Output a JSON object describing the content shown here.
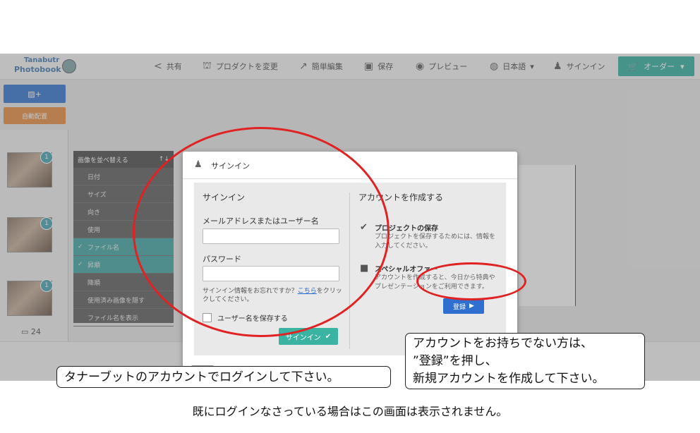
{
  "app": {
    "logo_top": "Tanabutr",
    "logo_bottom": "Photobook",
    "toolbar": {
      "share": "共有",
      "change_product": "プロダクトを変更",
      "easy_edit": "簡単編集",
      "save": "保存",
      "preview": "プレビュー",
      "language": "日本語",
      "signin": "サインイン",
      "order": "オーダー"
    },
    "left": {
      "auto_layout": "自動配置",
      "photo_count": "24"
    },
    "sort_panel": {
      "header": "画像を並べ替える",
      "items": [
        {
          "label": "日付",
          "checked": false
        },
        {
          "label": "サイズ",
          "checked": false
        },
        {
          "label": "向き",
          "checked": false
        },
        {
          "label": "使用",
          "checked": false
        },
        {
          "label": "ファイル名",
          "checked": true
        },
        {
          "label": "昇順",
          "checked": true
        },
        {
          "label": "降順",
          "checked": false
        },
        {
          "label": "使用済み画像を隠す",
          "checked": false
        },
        {
          "label": "ファイル名を表示",
          "checked": false
        }
      ]
    },
    "thumb_badges": [
      "1",
      "1",
      "1"
    ]
  },
  "modal": {
    "title": "サインイン",
    "signin": {
      "heading": "サインイン",
      "email_label": "メールアドレスまたはユーザー名",
      "email_value": "",
      "password_label": "パスワード",
      "password_value": "",
      "forgot_text": "サインイン情報をお忘れですか？",
      "forgot_link": "こちら",
      "forgot_text2": "をクリックしてください。",
      "remember_label": "ユーザー名を保存する",
      "submit_label": "サインイン"
    },
    "create": {
      "heading": "アカウントを作成する",
      "features": [
        {
          "title": "プロジェクトの保存",
          "text": "プロジェクトを保存するためには、情報を入力してください。"
        },
        {
          "title": "スペシャルオファー",
          "text": "アカウントを作成すると、今日から特典やプレゼンテーションをご利用できます。"
        }
      ],
      "register_label": "登録"
    }
  },
  "annotations": {
    "left_callout": "タナーブットのアカウントでログインして下さい。",
    "right_callout": [
      "アカウントをお持ちでない方は、",
      "”登録”を押し、",
      "新規アカウントを作成して下さい。"
    ],
    "footer_note": "既にログインなさっている場合はこの画面は表示されません。"
  },
  "colors": {
    "accent_teal": "#3bb3a3",
    "register_blue": "#2f6fd0",
    "annotation_red": "#e02222"
  }
}
